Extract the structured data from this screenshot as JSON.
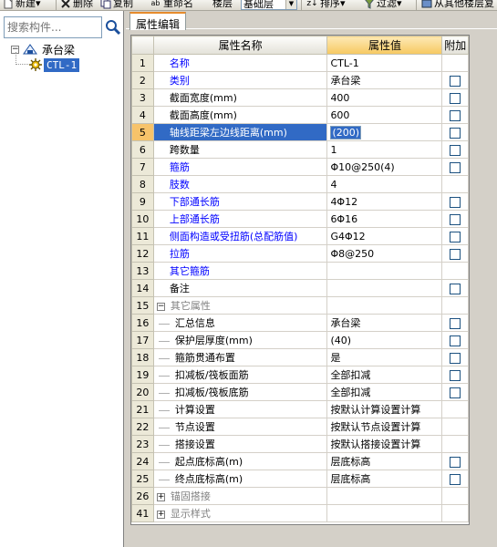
{
  "toolbar": {
    "items": [
      {
        "icon": "new-icon",
        "label": "新建▾"
      },
      {
        "icon": "delete-icon",
        "label": "删除"
      },
      {
        "icon": "copy-icon",
        "label": "复制"
      },
      {
        "icon": "rename-icon",
        "label": "重命名"
      },
      {
        "icon": "",
        "label": "楼层"
      },
      {
        "icon": "sort-icon",
        "label": "排序▾"
      },
      {
        "icon": "filter-icon",
        "label": "过滤▾"
      },
      {
        "icon": "copy-from-floor-icon",
        "label": "从其他楼层复"
      }
    ],
    "floor_select": "基础层"
  },
  "left": {
    "search_placeholder": "搜索构件...",
    "tree": {
      "root": {
        "label": "承台梁",
        "toggle": "−"
      },
      "child": {
        "label": "CTL-1"
      }
    }
  },
  "tab": {
    "label": "属性编辑"
  },
  "grid": {
    "headers": {
      "name": "属性名称",
      "value": "属性值",
      "extra": "附加"
    },
    "rows": [
      {
        "num": "1",
        "name": "名称",
        "value": "CTL-1",
        "style": "blue",
        "check": false
      },
      {
        "num": "2",
        "name": "类别",
        "value": "承台梁",
        "style": "blue",
        "check": true
      },
      {
        "num": "3",
        "name": "截面宽度(mm)",
        "value": "400",
        "style": "plain",
        "check": true
      },
      {
        "num": "4",
        "name": "截面高度(mm)",
        "value": "600",
        "style": "plain",
        "check": true
      },
      {
        "num": "5",
        "name": "轴线距梁左边线距离(mm)",
        "value": "(200)",
        "style": "selected",
        "check": true
      },
      {
        "num": "6",
        "name": "跨数量",
        "value": "1",
        "style": "plain",
        "check": true
      },
      {
        "num": "7",
        "name": "箍筋",
        "value": "Φ10@250(4)",
        "style": "blue",
        "check": true
      },
      {
        "num": "8",
        "name": "肢数",
        "value": "4",
        "style": "blue",
        "check": false
      },
      {
        "num": "9",
        "name": "下部通长筋",
        "value": "4Φ12",
        "style": "blue",
        "check": true
      },
      {
        "num": "10",
        "name": "上部通长筋",
        "value": "6Φ16",
        "style": "blue",
        "check": true
      },
      {
        "num": "11",
        "name": "侧面构造或受扭筋(总配筋值)",
        "value": "G4Φ12",
        "style": "blue",
        "check": true
      },
      {
        "num": "12",
        "name": "拉筋",
        "value": "Φ8@250",
        "style": "blue",
        "check": true
      },
      {
        "num": "13",
        "name": "其它箍筋",
        "value": "",
        "style": "blue",
        "check": false
      },
      {
        "num": "14",
        "name": "备注",
        "value": "",
        "style": "plain",
        "check": true
      },
      {
        "num": "15",
        "name": "其它属性",
        "value": "",
        "style": "group",
        "expander": "−",
        "check": false
      },
      {
        "num": "16",
        "name": "汇总信息",
        "value": "承台梁",
        "style": "child",
        "check": true
      },
      {
        "num": "17",
        "name": "保护层厚度(mm)",
        "value": "(40)",
        "style": "child",
        "check": true
      },
      {
        "num": "18",
        "name": "箍筋贯通布置",
        "value": "是",
        "style": "child",
        "check": true
      },
      {
        "num": "19",
        "name": "扣减板/筏板面筋",
        "value": "全部扣减",
        "style": "child",
        "check": true
      },
      {
        "num": "20",
        "name": "扣减板/筏板底筋",
        "value": "全部扣减",
        "style": "child",
        "check": true
      },
      {
        "num": "21",
        "name": "计算设置",
        "value": "按默认计算设置计算",
        "style": "child",
        "check": false
      },
      {
        "num": "22",
        "name": "节点设置",
        "value": "按默认节点设置计算",
        "style": "child",
        "check": false
      },
      {
        "num": "23",
        "name": "搭接设置",
        "value": "按默认搭接设置计算",
        "style": "child",
        "check": false
      },
      {
        "num": "24",
        "name": "起点底标高(m)",
        "value": "层底标高",
        "style": "child",
        "check": true
      },
      {
        "num": "25",
        "name": "终点底标高(m)",
        "value": "层底标高",
        "style": "child",
        "check": true
      },
      {
        "num": "26",
        "name": "锚固搭接",
        "value": "",
        "style": "group",
        "expander": "+",
        "check": false
      },
      {
        "num": "41",
        "name": "显示样式",
        "value": "",
        "style": "group",
        "expander": "+",
        "check": false
      }
    ]
  },
  "colors": {
    "selection": "#316ac5",
    "header_value_bg": "#f6c860",
    "link_blue": "#0000ff",
    "group_gray": "#808080"
  }
}
